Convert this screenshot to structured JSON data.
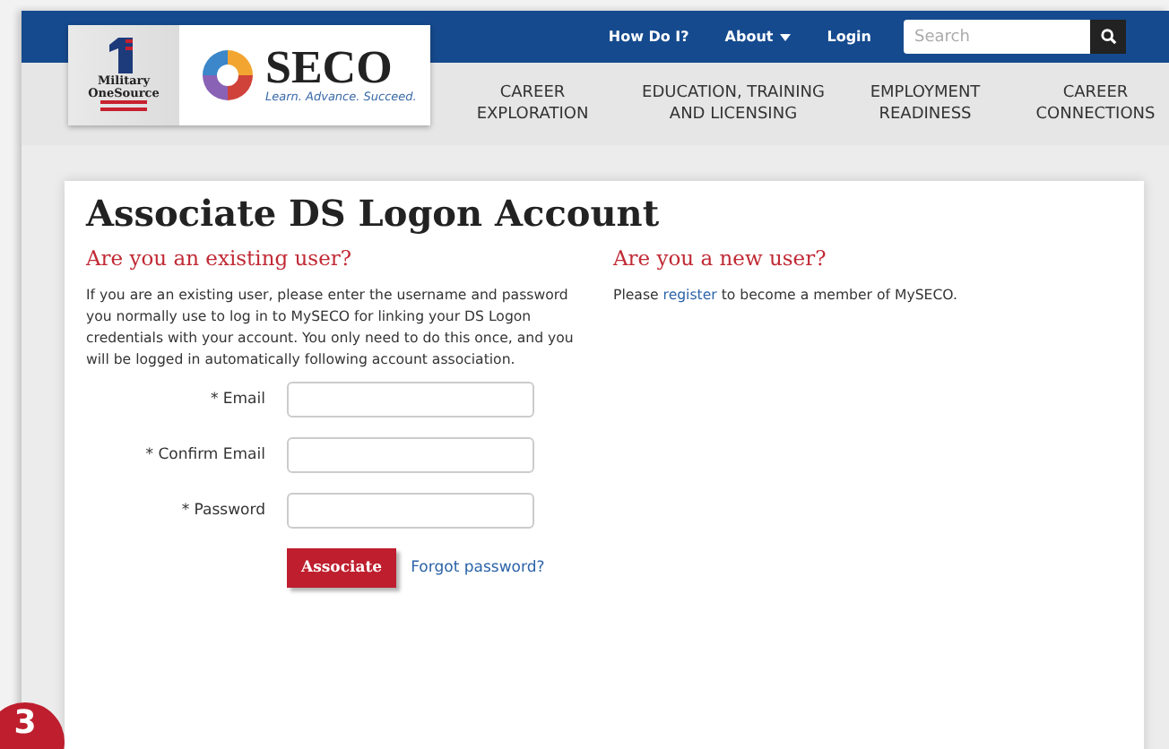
{
  "logos": {
    "military": [
      "Military",
      "OneSource"
    ],
    "seco": "SECO",
    "seco_tagline": "Learn. Advance. Succeed."
  },
  "top_links": [
    {
      "label": "How Do I?",
      "dropdown": false
    },
    {
      "label": "About",
      "dropdown": true
    },
    {
      "label": "Login",
      "dropdown": false
    }
  ],
  "search": {
    "placeholder": "Search"
  },
  "nav": [
    [
      "CAREER",
      "EXPLORATION"
    ],
    [
      "EDUCATION, TRAINING",
      "AND LICENSING"
    ],
    [
      "EMPLOYMENT",
      "READINESS"
    ],
    [
      "CAREER",
      "CONNECTIONS"
    ]
  ],
  "title": "Associate DS Logon Account",
  "existing": {
    "heading": "Are you an existing user?",
    "text": "If you are an existing user, please enter the username and password you normally use to log in to MySECO for linking your DS Logon credentials with your account. You only need to do this once, and you will be logged in automatically following account association.",
    "fields": [
      {
        "label": "* Email"
      },
      {
        "label": "* Confirm Email"
      },
      {
        "label": "* Password"
      }
    ],
    "button": "Associate",
    "forgot": "Forgot password?"
  },
  "new_user": {
    "heading": "Are you a new user?",
    "before": "Please ",
    "link": "register",
    "after": " to become a member of MySECO."
  },
  "badge": "3"
}
